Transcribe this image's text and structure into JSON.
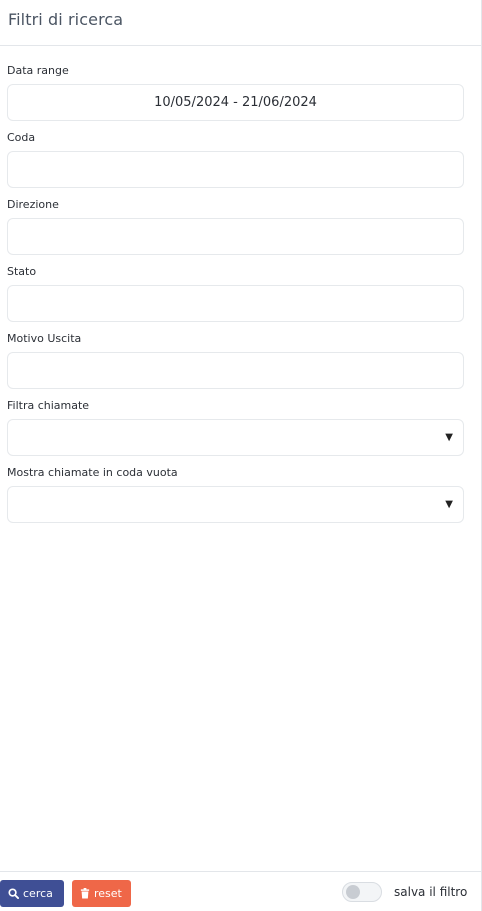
{
  "header": {
    "title": "Filtri di ricerca"
  },
  "fields": [
    {
      "label": "Data range",
      "value": "10/05/2024 - 21/06/2024",
      "type": "text"
    },
    {
      "label": "Coda",
      "value": "",
      "type": "text"
    },
    {
      "label": "Direzione",
      "value": "",
      "type": "text"
    },
    {
      "label": "Stato",
      "value": "",
      "type": "text"
    },
    {
      "label": "Motivo Uscita",
      "value": "",
      "type": "text"
    },
    {
      "label": "Filtra chiamate",
      "value": "",
      "type": "select"
    },
    {
      "label": "Mostra chiamate in coda vuota",
      "value": "",
      "type": "select"
    }
  ],
  "footer": {
    "search_label": "cerca",
    "reset_label": "reset",
    "save_filter_label": "salva il filtro",
    "save_filter_on": false
  },
  "icons": {
    "search": "search-icon",
    "reset": "trash-icon",
    "dropdown": "caret-down-icon"
  },
  "colors": {
    "search_button": "#3f4f95",
    "reset_button": "#ef6748"
  }
}
